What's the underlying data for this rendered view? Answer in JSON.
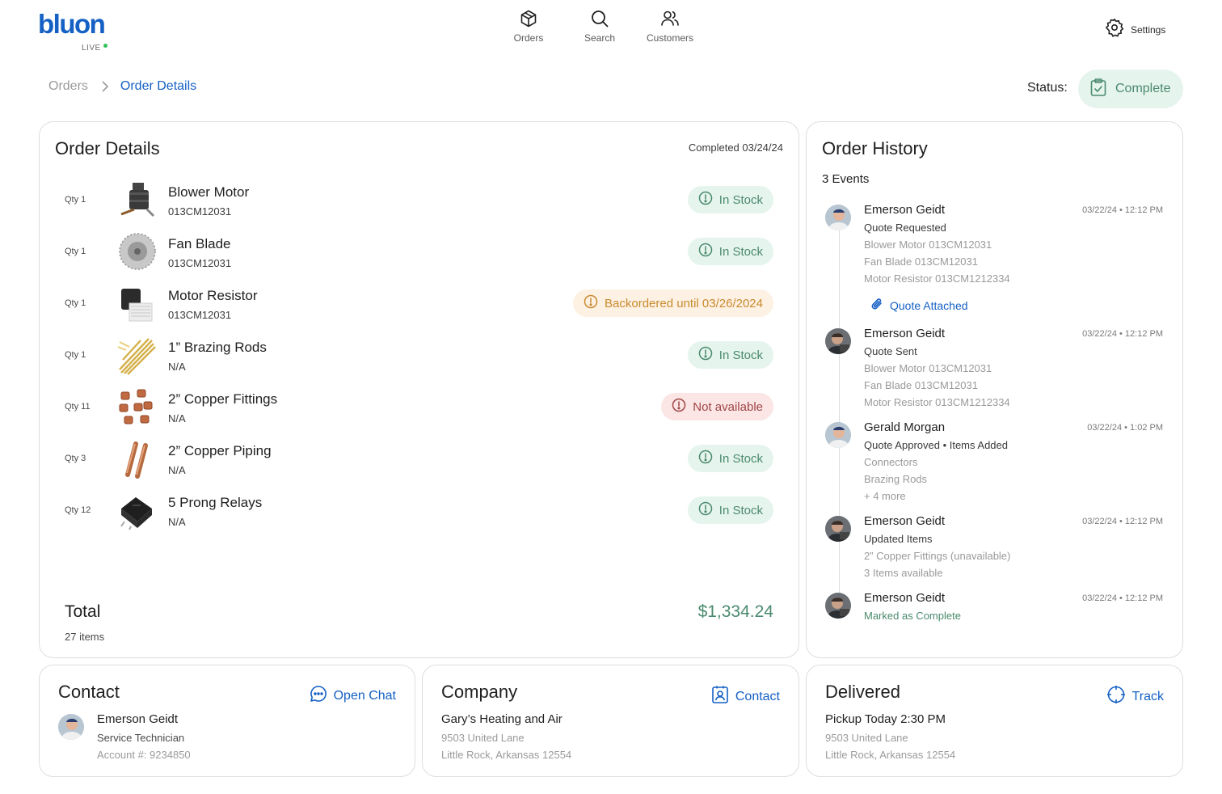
{
  "logo": {
    "word": "bluon",
    "sub": "LIVE"
  },
  "nav": [
    {
      "label": "Orders",
      "icon": "box-icon"
    },
    {
      "label": "Search",
      "icon": "search-icon"
    },
    {
      "label": "Customers",
      "icon": "users-icon"
    }
  ],
  "settings": {
    "label": "Settings",
    "icon": "gear-icon"
  },
  "breadcrumb": {
    "root": "Orders",
    "current": "Order Details"
  },
  "status": {
    "label": "Status:",
    "value": "Complete"
  },
  "order": {
    "title": "Order Details",
    "completed": "Completed 03/24/24",
    "items": [
      {
        "qty": "Qty 1",
        "name": "Blower Motor",
        "sku": "013CM12031",
        "status": "In Stock",
        "kind": "in",
        "thumb": "motor"
      },
      {
        "qty": "Qty 1",
        "name": "Fan Blade",
        "sku": "013CM12031",
        "status": "In Stock",
        "kind": "in",
        "thumb": "fan"
      },
      {
        "qty": "Qty 1",
        "name": "Motor Resistor",
        "sku": "013CM12031",
        "status": "Backordered until 03/26/2024",
        "kind": "back",
        "thumb": "resistor"
      },
      {
        "qty": "Qty 1",
        "name": "1” Brazing Rods",
        "sku": "N/A",
        "status": "In Stock",
        "kind": "in",
        "thumb": "rods"
      },
      {
        "qty": "Qty 11",
        "name": "2” Copper Fittings",
        "sku": "N/A",
        "status": "Not available",
        "kind": "na",
        "thumb": "fittings"
      },
      {
        "qty": "Qty 3",
        "name": "2” Copper Piping",
        "sku": "N/A",
        "status": "In Stock",
        "kind": "in",
        "thumb": "piping"
      },
      {
        "qty": "Qty 12",
        "name": "5 Prong Relays",
        "sku": "N/A",
        "status": "In Stock",
        "kind": "in",
        "thumb": "relay"
      }
    ],
    "total_label": "Total",
    "total_items": "27 items",
    "total_amount": "$1,334.24"
  },
  "history": {
    "title": "Order History",
    "count": "3 Events",
    "events": [
      {
        "who": "Emerson Geidt",
        "when": "03/22/24 • 12:12 PM",
        "action": "Quote Requested",
        "green": false,
        "details": [
          "Blower Motor 013CM12031",
          "Fan Blade 013CM12031",
          "Motor Resistor 013CM1212334"
        ],
        "attachment": "Quote Attached"
      },
      {
        "who": "Emerson Geidt",
        "when": "03/22/24 • 12:12 PM",
        "action": "Quote Sent",
        "green": false,
        "details": [
          "Blower Motor 013CM12031",
          "Fan Blade 013CM12031",
          "Motor Resistor 013CM1212334"
        ]
      },
      {
        "who": "Gerald Morgan",
        "when": "03/22/24 • 1:02 PM",
        "action": "Quote Approved • Items Added",
        "green": false,
        "details": [
          "Connectors",
          "Brazing Rods",
          "+ 4 more"
        ]
      },
      {
        "who": "Emerson Geidt",
        "when": "03/22/24 • 12:12 PM",
        "action": "Updated Items",
        "green": false,
        "details": [
          "2” Copper Fittings (unavailable)",
          "3 Items available"
        ]
      },
      {
        "who": "Emerson Geidt",
        "when": "03/22/24 • 12:12 PM",
        "action": "Marked as Complete",
        "green": true,
        "details": []
      }
    ]
  },
  "contact": {
    "title": "Contact",
    "action": "Open Chat",
    "name": "Emerson Geidt",
    "role": "Service Technician",
    "account": "Account #: 9234850"
  },
  "company": {
    "title": "Company",
    "action": "Contact",
    "name": "Gary’s Heating and Air",
    "address1": "9503 United Lane",
    "address2": "Little Rock, Arkansas 12554"
  },
  "delivered": {
    "title": "Delivered",
    "action": "Track",
    "pickup": "Pickup Today 2:30 PM",
    "address1": "9503 United Lane",
    "address2": "Little Rock, Arkansas 12554"
  },
  "colors": {
    "brand": "#1560c4",
    "green": "#4a8a6e",
    "green_bg": "#e6f4ee",
    "orange": "#c98a2e",
    "orange_bg": "#fdf1e3",
    "red": "#a04545",
    "red_bg": "#fbe5e5"
  }
}
